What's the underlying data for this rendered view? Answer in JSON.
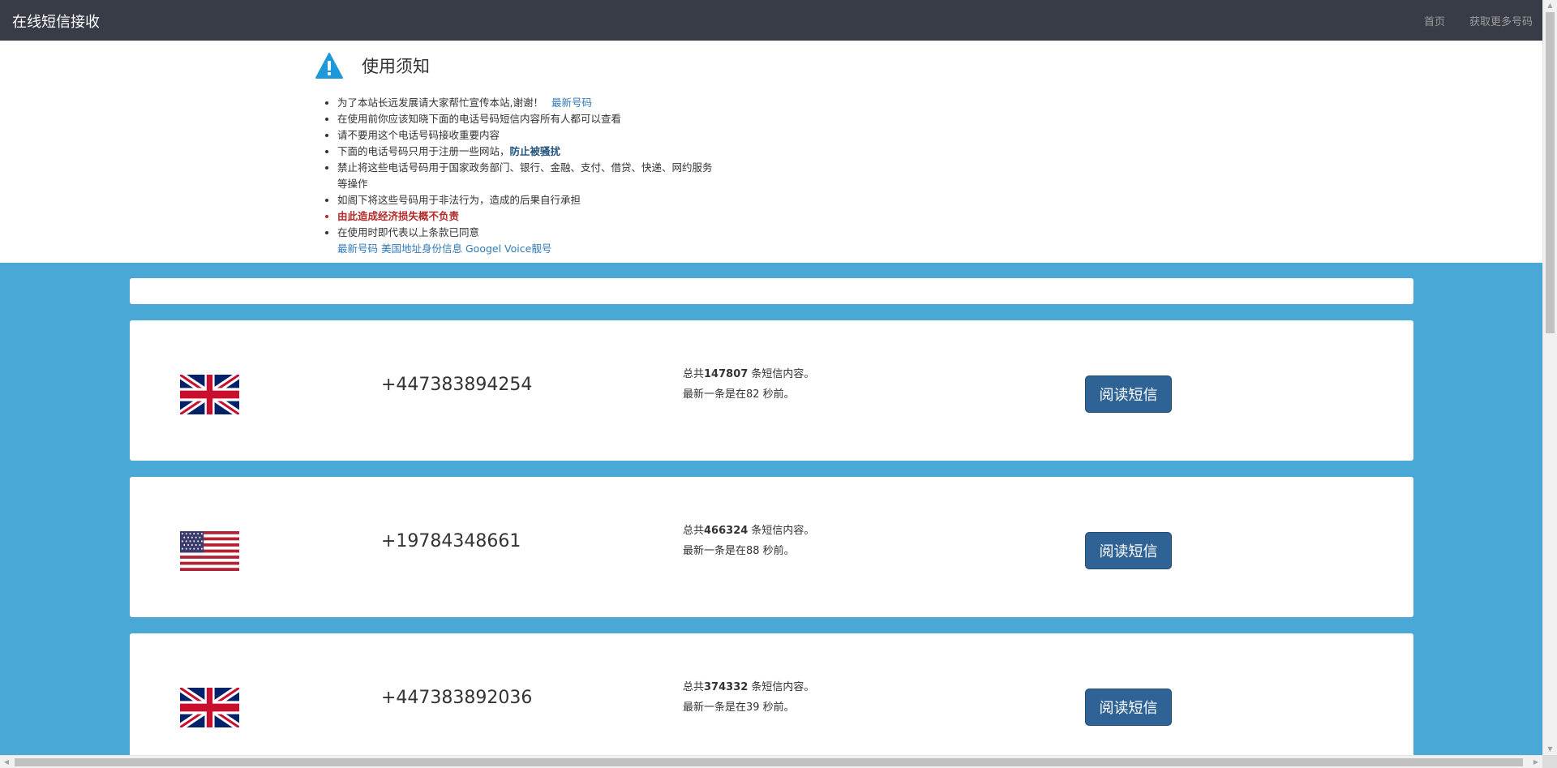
{
  "navbar": {
    "brand": "在线短信接收",
    "links": [
      "首页",
      "获取更多号码"
    ]
  },
  "notice": {
    "title": "使用须知",
    "items": {
      "i1_text": "为了本站长远发展请大家帮忙宣传本站,谢谢！",
      "i1_link": "最新号码",
      "i2": "在使用前你应该知晓下面的电话号码短信内容所有人都可以查看",
      "i3": "请不要用这个电话号码接收重要内容",
      "i4_text": "下面的电话号码只用于注册一些网站，",
      "i4_link": "防止被骚扰",
      "i5_line1": "禁止将这些电话号码用于国家政务部门、银行、金融、支付、借贷、快递、网约服务",
      "i5_line2": "等操作",
      "i6": "如阁下将这些号码用于非法行为，造成的后果自行承担",
      "i7": "由此造成经济损失概不负责",
      "i8": "在使用时即代表以上条款已同意",
      "links": [
        "最新号码",
        "美国地址身份信息",
        "Googel Voice靓号"
      ]
    }
  },
  "numbers": [
    {
      "flag": "uk-flag-icon",
      "phone": "+447383894254",
      "prefix": "总共",
      "count": "147807",
      "suffix": " 条短信内容。",
      "latest": "最新一条是在82 秒前。",
      "button": "阅读短信"
    },
    {
      "flag": "us-flag-icon",
      "phone": "+19784348661",
      "prefix": "总共",
      "count": "466324",
      "suffix": " 条短信内容。",
      "latest": "最新一条是在88 秒前。",
      "button": "阅读短信"
    },
    {
      "flag": "uk-flag-icon",
      "phone": "+447383892036",
      "prefix": "总共",
      "count": "374332",
      "suffix": " 条短信内容。",
      "latest": "最新一条是在39 秒前。",
      "button": "阅读短信"
    }
  ],
  "colors": {
    "navbar": "#383c47",
    "content_bg": "#4aa8d6",
    "button": "#2f6295",
    "link": "#337ab7",
    "warning": "#b22a2a"
  }
}
